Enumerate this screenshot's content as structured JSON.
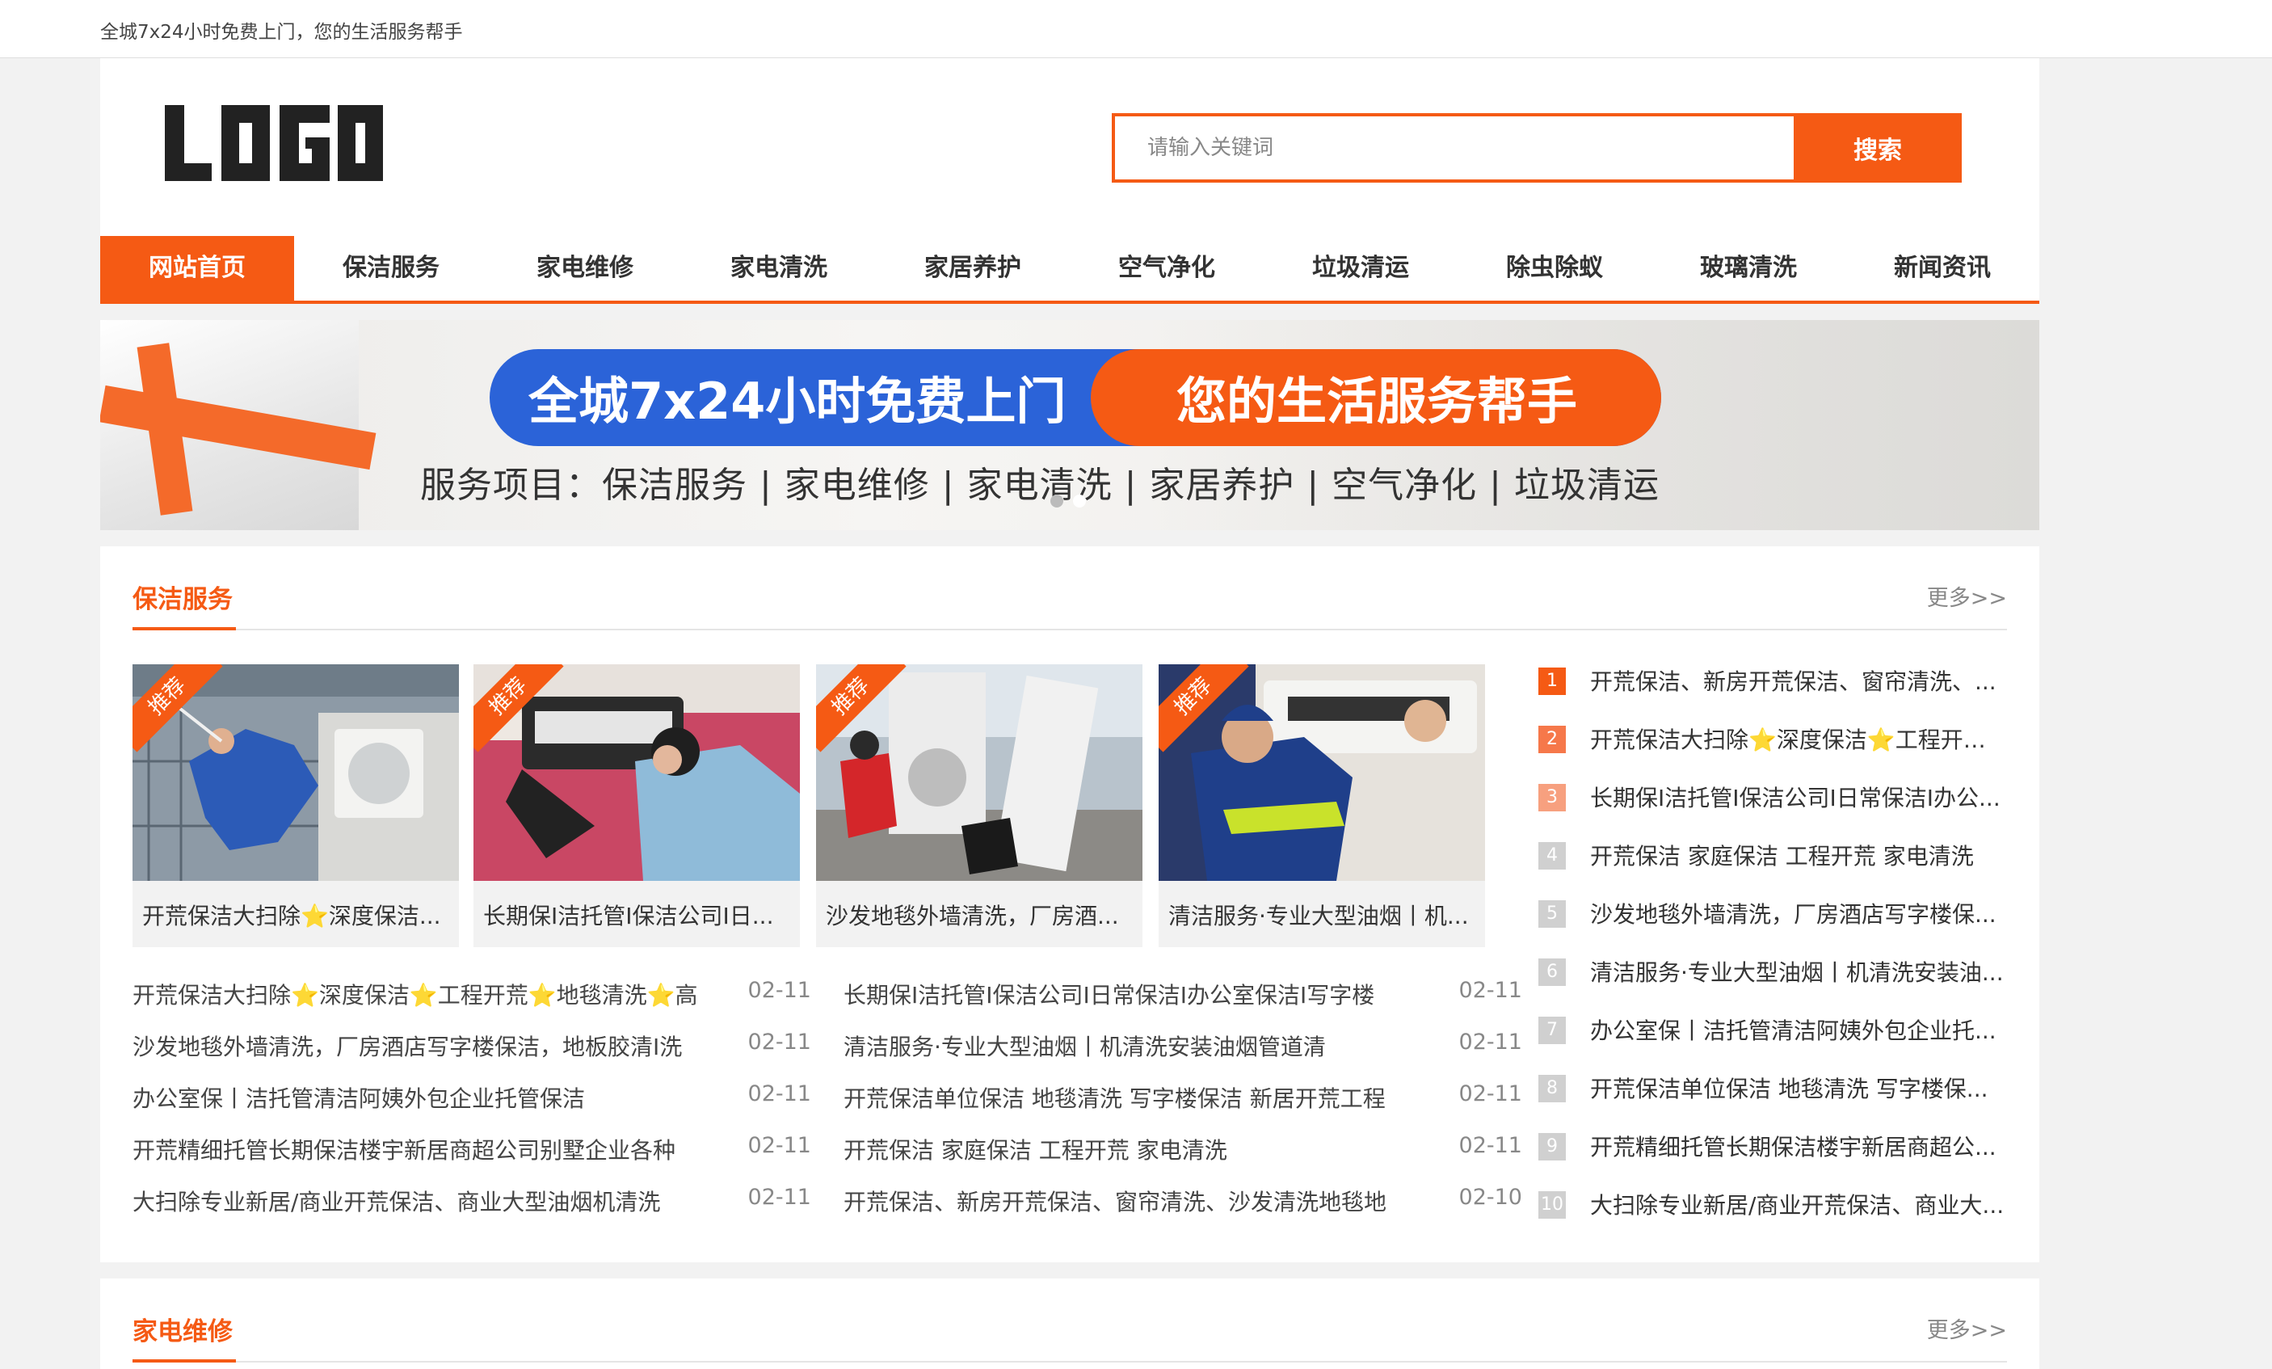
{
  "topbar": {
    "text": "全城7x24小时免费上门，您的生活服务帮手"
  },
  "header": {
    "logo_text": "LOGO",
    "search": {
      "placeholder": "请输入关键词",
      "button_label": "搜索"
    }
  },
  "nav": {
    "items": [
      {
        "label": "网站首页"
      },
      {
        "label": "保洁服务"
      },
      {
        "label": "家电维修"
      },
      {
        "label": "家电清洗"
      },
      {
        "label": "家居养护"
      },
      {
        "label": "空气净化"
      },
      {
        "label": "垃圾清运"
      },
      {
        "label": "除虫除蚁"
      },
      {
        "label": "玻璃清洗"
      },
      {
        "label": "新闻资讯"
      }
    ]
  },
  "banner": {
    "headline_left": "全城7x24小时免费上门",
    "headline_right": "您的生活服务帮手",
    "subline": "服务项目：保洁服务 | 家电维修 | 家电清洗 | 家居养护 | 空气净化 | 垃圾清运"
  },
  "section1": {
    "title": "保洁服务",
    "more": "更多>>",
    "cards": [
      {
        "badge": "推荐",
        "caption": "开荒保洁大扫除⭐深度保洁..."
      },
      {
        "badge": "推荐",
        "caption": "长期保I洁托管I保洁公司I日..."
      },
      {
        "badge": "推荐",
        "caption": "沙发地毯外墙清洗，厂房酒..."
      },
      {
        "badge": "推荐",
        "caption": "清洁服务·专业大型油烟丨机..."
      }
    ],
    "list_left": [
      {
        "title": "开荒保洁大扫除⭐深度保洁⭐工程开荒⭐地毯清洗⭐高",
        "date": "02-11"
      },
      {
        "title": "沙发地毯外墙清洗，厂房酒店写字楼保洁，地板胶清I洗",
        "date": "02-11"
      },
      {
        "title": "办公室保丨洁托管清洁阿姨外包企业托管保洁",
        "date": "02-11"
      },
      {
        "title": "开荒精细托管长期保洁楼宇新居商超公司别墅企业各种",
        "date": "02-11"
      },
      {
        "title": "大扫除专业新居/商业开荒保洁、商业大型油烟机清洗",
        "date": "02-11"
      }
    ],
    "list_right": [
      {
        "title": "长期保I洁托管I保洁公司I日常保洁I办公室保洁I写字楼",
        "date": "02-11"
      },
      {
        "title": "清洁服务·专业大型油烟丨机清洗安装油烟管道清",
        "date": "02-11"
      },
      {
        "title": "开荒保洁单位保洁 地毯清洗 写字楼保洁 新居开荒工程",
        "date": "02-11"
      },
      {
        "title": "开荒保洁 家庭保洁 工程开荒 家电清洗",
        "date": "02-11"
      },
      {
        "title": "开荒保洁、新房开荒保洁、窗帘清洗、沙发清洗地毯地",
        "date": "02-10"
      }
    ],
    "ranking": [
      {
        "num": "1",
        "title": "开荒保洁、新房开荒保洁、窗帘清洗、..."
      },
      {
        "num": "2",
        "title": "开荒保洁大扫除⭐深度保洁⭐工程开荒..."
      },
      {
        "num": "3",
        "title": "长期保I洁托管I保洁公司I日常保洁I办公..."
      },
      {
        "num": "4",
        "title": "开荒保洁 家庭保洁 工程开荒 家电清洗"
      },
      {
        "num": "5",
        "title": "沙发地毯外墙清洗，厂房酒店写字楼保..."
      },
      {
        "num": "6",
        "title": "清洁服务·专业大型油烟丨机清洗安装油..."
      },
      {
        "num": "7",
        "title": "办公室保丨洁托管清洁阿姨外包企业托..."
      },
      {
        "num": "8",
        "title": "开荒保洁单位保洁 地毯清洗 写字楼保..."
      },
      {
        "num": "9",
        "title": "开荒精细托管长期保洁楼宇新居商超公..."
      },
      {
        "num": "10",
        "title": "大扫除专业新居/商业开荒保洁、商业大..."
      }
    ]
  },
  "section2": {
    "title": "家电维修",
    "more": "更多>>"
  },
  "colors": {
    "accent": "#f55a14",
    "banner_blue": "#2b63d8"
  }
}
